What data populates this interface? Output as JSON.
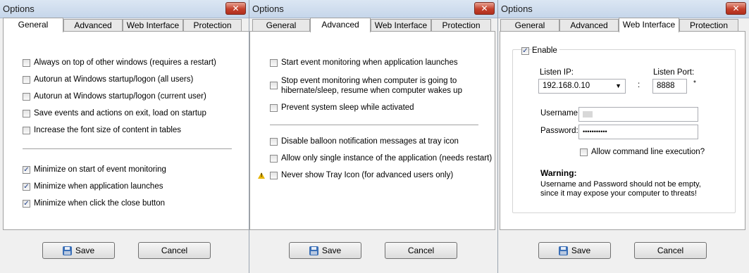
{
  "windows": [
    {
      "title": "Options",
      "close_label": "✕",
      "tabs": [
        "General",
        "Advanced",
        "Web Interface",
        "Protection"
      ],
      "active_tab": "General",
      "options": [
        {
          "label": "Always on top of other windows (requires a restart)",
          "checked": false
        },
        {
          "label": "Autorun at Windows startup/logon (all users)",
          "checked": false
        },
        {
          "label": "Autorun at Windows startup/logon (current user)",
          "checked": false
        },
        {
          "label": "Save events and actions on exit, load on startup",
          "checked": false
        },
        {
          "label": "Increase the font size of content in tables",
          "checked": false
        },
        {
          "label": "Minimize on start of event monitoring",
          "checked": true
        },
        {
          "label": "Minimize when application launches",
          "checked": true
        },
        {
          "label": "Minimize when click the close button",
          "checked": true
        }
      ],
      "save_label": "Save",
      "cancel_label": "Cancel"
    },
    {
      "title": "Options",
      "close_label": "✕",
      "tabs": [
        "General",
        "Advanced",
        "Web Interface",
        "Protection"
      ],
      "active_tab": "Advanced",
      "options": [
        {
          "label": "Start event monitoring when application launches",
          "checked": false
        },
        {
          "label": "Stop event monitoring when computer is going to",
          "label2": "hibernate/sleep, resume when computer wakes up",
          "checked": false
        },
        {
          "label": "Prevent system sleep while activated",
          "checked": false
        },
        {
          "label": "Disable balloon notification messages at tray icon",
          "checked": false
        },
        {
          "label": "Allow only single instance of the application (needs restart)",
          "checked": false
        },
        {
          "label": "Never show Tray Icon (for advanced users only)",
          "checked": false
        }
      ],
      "save_label": "Save",
      "cancel_label": "Cancel"
    },
    {
      "title": "Options",
      "close_label": "✕",
      "tabs": [
        "General",
        "Advanced",
        "Web Interface",
        "Protection"
      ],
      "active_tab": "Web Interface",
      "enable": {
        "label": "Enable",
        "checked": true
      },
      "listen_ip": {
        "label": "Listen IP:",
        "value": "192.168.0.10"
      },
      "colon": ":",
      "listen_port": {
        "label": "Listen Port:",
        "value": "8888",
        "marker": "*"
      },
      "username": {
        "label": "Username:",
        "value": ""
      },
      "password": {
        "label": "Password:",
        "value": "•••••••••••"
      },
      "allow_cmd": {
        "label": "Allow command line execution?",
        "checked": false
      },
      "warning_title": "Warning:",
      "warning_line1": "Username and Password should not be empty,",
      "warning_line2": "since it may expose your computer to threats!",
      "save_label": "Save",
      "cancel_label": "Cancel"
    }
  ]
}
